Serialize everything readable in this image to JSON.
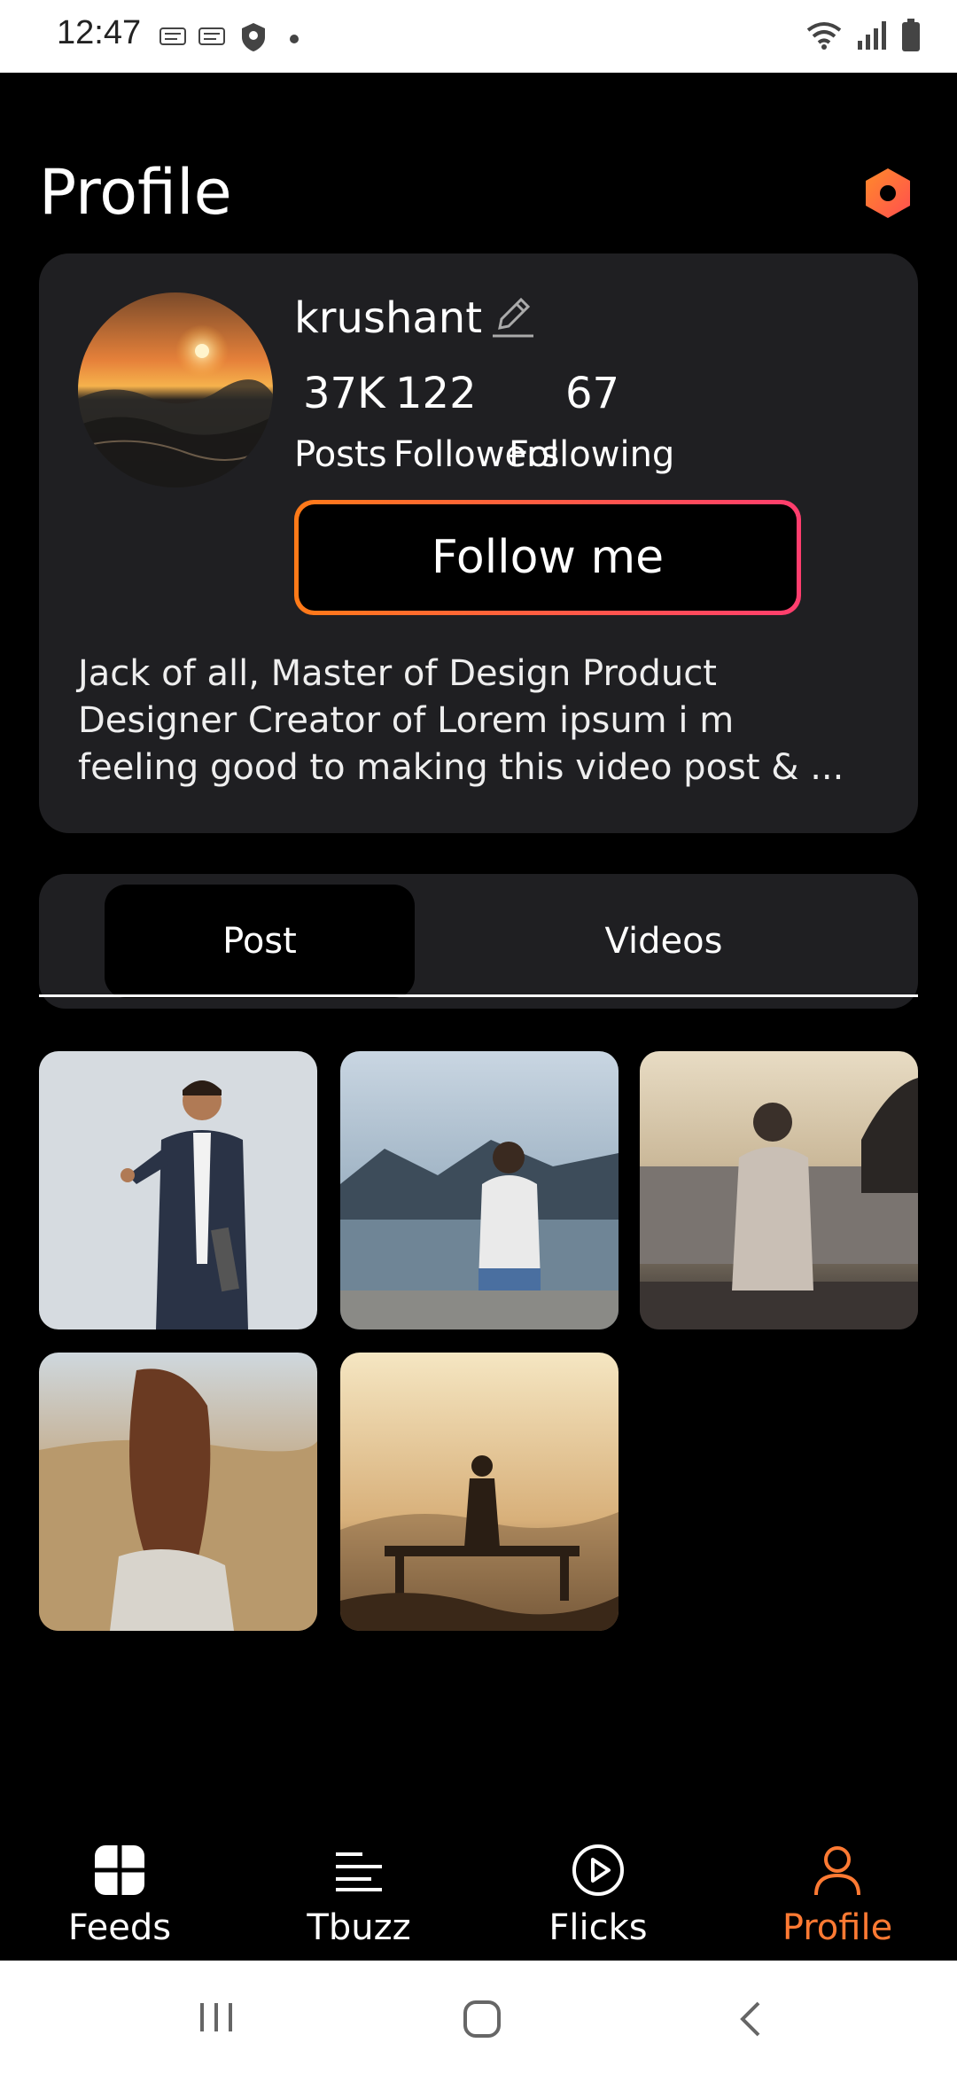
{
  "status_bar": {
    "time": "12:47",
    "notification_icons": [
      "news-icon",
      "news-icon",
      "shield-icon",
      "dot-icon"
    ],
    "right_icons": [
      "wifi-icon",
      "signal-icon",
      "battery-icon"
    ]
  },
  "header": {
    "title": "Profile",
    "settings_icon": "hexagon-settings-icon",
    "accent": "#ff6a2b"
  },
  "profile": {
    "username": "krushant",
    "stats": [
      {
        "value": "37K",
        "label": "Posts"
      },
      {
        "value": "122",
        "label": "Followers"
      },
      {
        "value": "67",
        "label": "Following"
      }
    ],
    "follow_button": "Follow me",
    "bio_lines": [
      "Jack of all, Master of Design  Product",
      "Designer Creator of Lorem ipsum i m",
      "feeling good to making this video post & ..."
    ]
  },
  "tabs": [
    {
      "label": "Post",
      "active": true
    },
    {
      "label": "Videos",
      "active": false
    }
  ],
  "posts": [
    {
      "name": "post-businessman"
    },
    {
      "name": "post-man-by-lake"
    },
    {
      "name": "post-man-sunset-sea"
    },
    {
      "name": "post-woman-field"
    },
    {
      "name": "post-silhouette-bench"
    }
  ],
  "bottom_nav": [
    {
      "label": "Feeds",
      "icon": "grid-icon",
      "active": false
    },
    {
      "label": "Tbuzz",
      "icon": "lines-icon",
      "active": false
    },
    {
      "label": "Flicks",
      "icon": "play-circle-icon",
      "active": false
    },
    {
      "label": "Profile",
      "icon": "person-icon",
      "active": true
    }
  ],
  "colors": {
    "background": "#000000",
    "card": "#1f1f22",
    "accent": "#ff7a33",
    "gradient_start": "#ff7a18",
    "gradient_end": "#ff3d6e"
  }
}
